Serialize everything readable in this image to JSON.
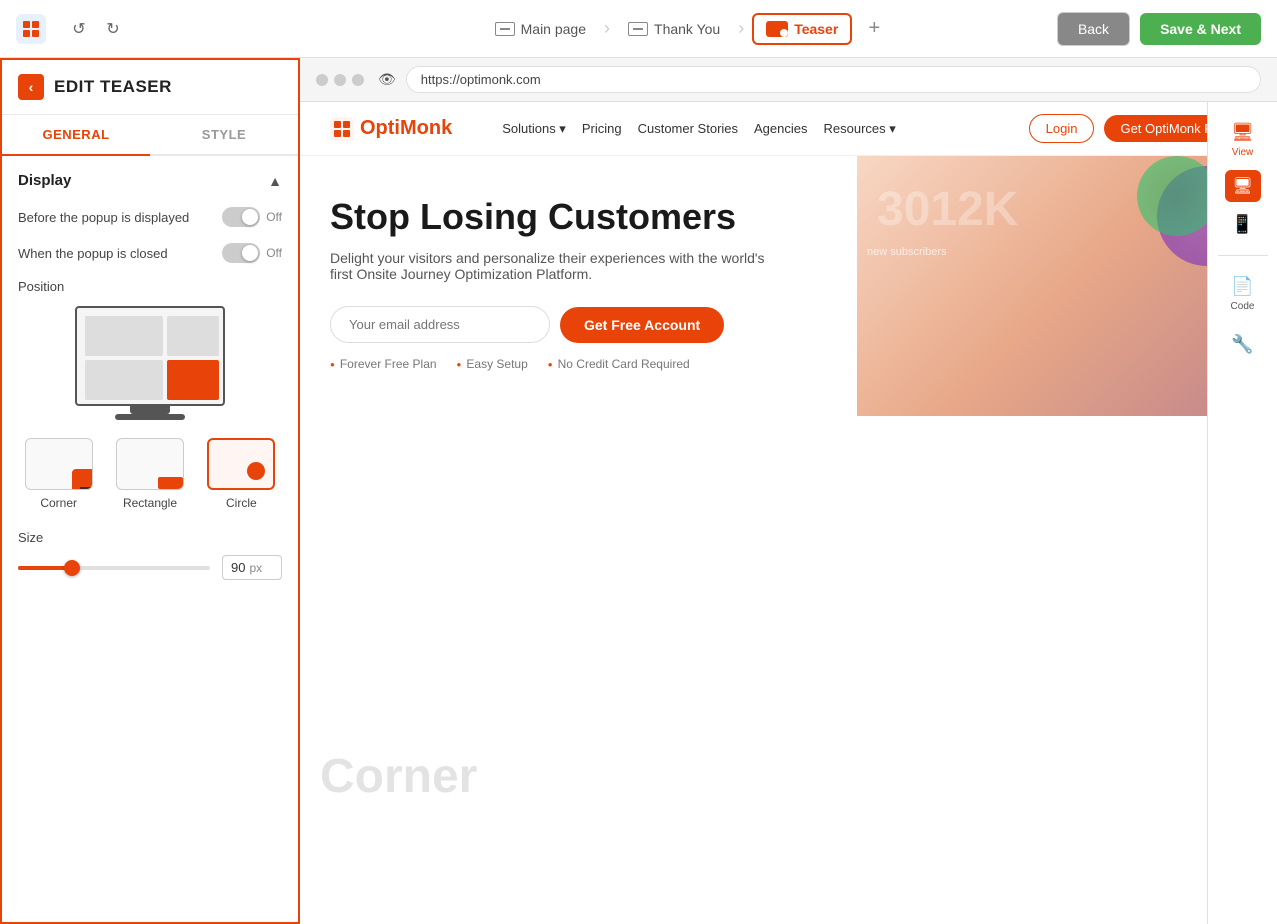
{
  "topBar": {
    "appName": "OptiMonk",
    "undoTitle": "Undo",
    "redoTitle": "Redo",
    "undoIcon": "↺",
    "redoIcon": "↻",
    "pages": [
      {
        "id": "main",
        "label": "Main page"
      },
      {
        "id": "thankyou",
        "label": "Thank You"
      },
      {
        "id": "teaser",
        "label": "Teaser",
        "active": true
      }
    ],
    "addPageTitle": "+",
    "backLabel": "Back",
    "saveNextLabel": "Save & Next"
  },
  "leftPanel": {
    "editTitle": "EDIT TEASER",
    "backArrow": "‹",
    "tabs": [
      {
        "id": "general",
        "label": "GENERAL",
        "active": true
      },
      {
        "id": "style",
        "label": "STYLE"
      }
    ],
    "display": {
      "sectionTitle": "Display",
      "beforePopup": {
        "label": "Before the popup is displayed",
        "value": "Off"
      },
      "whenClosed": {
        "label": "When the popup is closed",
        "value": "Off"
      }
    },
    "position": {
      "label": "Position"
    },
    "shapes": [
      {
        "id": "corner",
        "label": "Corner",
        "selected": false
      },
      {
        "id": "rectangle",
        "label": "Rectangle",
        "selected": false
      },
      {
        "id": "circle",
        "label": "Circle",
        "selected": true
      }
    ],
    "size": {
      "label": "Size",
      "value": "90",
      "unit": "px",
      "sliderPercent": 28
    }
  },
  "browser": {
    "url": "https://optimonk.com"
  },
  "preview": {
    "nav": {
      "logo": "OptiMonk",
      "links": [
        "Solutions ▾",
        "Pricing",
        "Customer Stories",
        "Agencies",
        "Resources ▾"
      ],
      "loginLabel": "Login",
      "getFreeLabel": "Get OptiMonk Free"
    },
    "hero": {
      "headline": "Stop Losing Customers",
      "description": "Delight your visitors and personalize their experiences with the world's first Onsite Journey Optimization Platform.",
      "emailPlaceholder": "Your email address",
      "ctaLabel": "Get Free Account",
      "features": [
        "Forever Free Plan",
        "Easy Setup",
        "No Credit Card Required"
      ]
    },
    "tools": [
      {
        "id": "view",
        "label": "View",
        "icon": "🖥",
        "active": true
      },
      {
        "id": "mobile",
        "label": "",
        "icon": "📱",
        "active": false
      },
      {
        "id": "code",
        "label": "Code",
        "icon": "📄",
        "active": false
      },
      {
        "id": "codealt",
        "label": "",
        "icon": "🔧",
        "active": false
      }
    ],
    "cornerLabel": "Corner"
  }
}
